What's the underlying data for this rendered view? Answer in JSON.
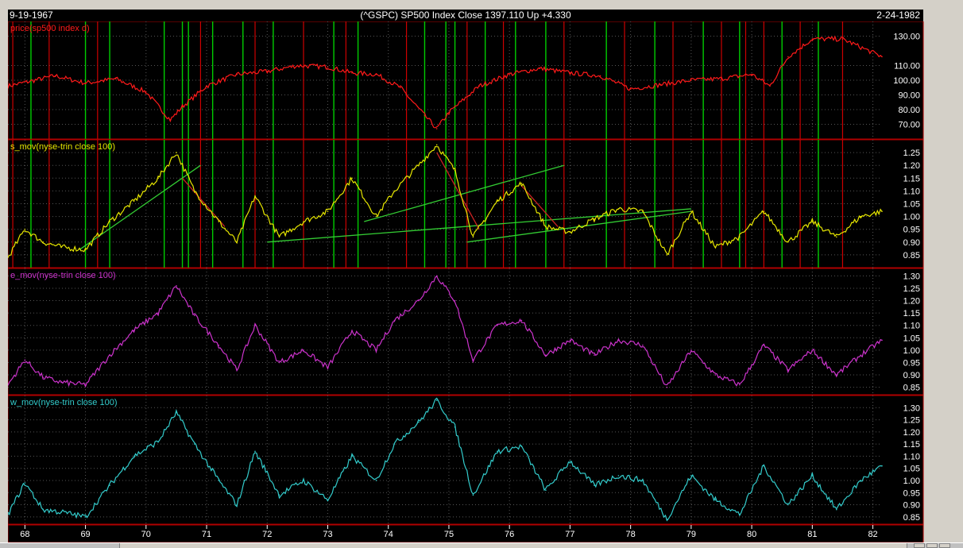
{
  "header": {
    "start_date": "9-19-1967",
    "title": "(^GSPC)  SP500 Index    Close 1397.110   Up +4.330",
    "end_date": "2-24-1982"
  },
  "colors": {
    "background": "#000000",
    "panel_border": "#b00000",
    "price_line": "#ff1a1a",
    "s_mov_line": "#e6e600",
    "e_mov_line": "#cc33cc",
    "w_mov_line": "#33cccc",
    "buy_marker": "#00cc00",
    "sell_marker": "#cc0000",
    "trend_up": "#33cc33",
    "trend_down": "#cc2222",
    "axis_text": "#ffffff",
    "grid": "#555555"
  },
  "chart_data": [
    {
      "type": "line",
      "title": "price(sp500 index d)",
      "yticks": [
        70,
        80,
        90,
        100,
        110,
        130
      ],
      "ytick_labels": [
        "70.00",
        "80.00",
        "90.00",
        "100.00",
        "110.00",
        "130.00"
      ],
      "ylim": [
        60,
        140
      ],
      "x": [
        67.72,
        68.5,
        69.0,
        69.5,
        70.0,
        70.4,
        70.6,
        71.0,
        71.5,
        72.0,
        72.5,
        73.0,
        73.4,
        73.8,
        74.2,
        74.6,
        74.8,
        75.0,
        75.5,
        76.0,
        76.5,
        77.0,
        77.5,
        78.0,
        78.5,
        79.0,
        79.5,
        80.0,
        80.3,
        80.6,
        81.0,
        81.5,
        82.15
      ],
      "y": [
        96,
        103,
        98,
        101,
        92,
        73,
        82,
        96,
        104,
        106,
        110,
        109,
        105,
        104,
        95,
        76,
        67,
        78,
        96,
        104,
        108,
        105,
        103,
        94,
        97,
        100,
        101,
        104,
        96,
        116,
        128,
        128,
        116
      ],
      "buy_signals_x": [
        68.1,
        69.0,
        69.4,
        70.3,
        70.6,
        70.7,
        71.1,
        71.6,
        72.1,
        73.1,
        73.5,
        74.6,
        74.95,
        75.1,
        75.6,
        76.1,
        76.6,
        77.6,
        78.4,
        79.2,
        79.8,
        80.5,
        81.1
      ],
      "sell_signals_x": [
        67.8,
        68.4,
        69.2,
        70.9,
        71.8,
        72.6,
        73.3,
        74.3,
        75.3,
        75.9,
        76.9,
        77.9,
        78.7,
        79.5,
        79.9,
        80.2,
        80.8,
        81.5
      ]
    },
    {
      "type": "line",
      "title": "s_mov(nyse-trin close 100)",
      "yticks": [
        0.85,
        0.9,
        0.95,
        1.0,
        1.05,
        1.1,
        1.15,
        1.2,
        1.25
      ],
      "ytick_labels": [
        "0.85",
        "0.90",
        "0.95",
        "1.00",
        "1.05",
        "1.10",
        "1.15",
        "1.20",
        "1.25"
      ],
      "ylim": [
        0.8,
        1.3
      ],
      "x": [
        67.72,
        68.0,
        68.3,
        68.6,
        69.0,
        69.4,
        69.8,
        70.2,
        70.5,
        70.8,
        71.2,
        71.5,
        71.8,
        72.2,
        72.6,
        73.0,
        73.4,
        73.8,
        74.1,
        74.5,
        74.8,
        75.1,
        75.4,
        75.8,
        76.2,
        76.6,
        77.0,
        77.4,
        77.8,
        78.2,
        78.6,
        79.0,
        79.4,
        79.8,
        80.2,
        80.6,
        81.0,
        81.4,
        81.8,
        82.15
      ],
      "y": [
        0.84,
        0.95,
        0.9,
        0.88,
        0.87,
        0.98,
        1.06,
        1.15,
        1.25,
        1.1,
        0.98,
        0.9,
        1.08,
        0.92,
        0.98,
        1.02,
        1.15,
        1.0,
        1.1,
        1.2,
        1.28,
        1.18,
        0.92,
        1.06,
        1.13,
        0.96,
        0.94,
        0.99,
        1.03,
        1.02,
        0.85,
        1.02,
        0.88,
        0.92,
        1.02,
        0.9,
        0.98,
        0.92,
        1.0,
        1.02
      ],
      "trendlines": [
        {
          "dir": "up",
          "x": [
            68.9,
            70.9
          ],
          "y": [
            0.87,
            1.2
          ]
        },
        {
          "dir": "up",
          "x": [
            72.0,
            79.0
          ],
          "y": [
            0.9,
            1.03
          ]
        },
        {
          "dir": "up",
          "x": [
            73.6,
            76.9
          ],
          "y": [
            0.98,
            1.2
          ]
        },
        {
          "dir": "up",
          "x": [
            75.3,
            79.0
          ],
          "y": [
            0.9,
            1.02
          ]
        },
        {
          "dir": "down",
          "x": [
            70.6,
            71.3
          ],
          "y": [
            1.15,
            0.96
          ]
        },
        {
          "dir": "down",
          "x": [
            74.8,
            75.5
          ],
          "y": [
            1.25,
            0.95
          ]
        },
        {
          "dir": "down",
          "x": [
            76.2,
            76.8
          ],
          "y": [
            1.12,
            0.96
          ]
        }
      ]
    },
    {
      "type": "line",
      "title": "e_mov(nyse-trin close 100)",
      "yticks": [
        0.85,
        0.9,
        0.95,
        1.0,
        1.05,
        1.1,
        1.15,
        1.2,
        1.25,
        1.3
      ],
      "ytick_labels": [
        "0.85",
        "0.90",
        "0.95",
        "1.00",
        "1.05",
        "1.10",
        "1.15",
        "1.20",
        "1.25",
        "1.30"
      ],
      "ylim": [
        0.82,
        1.33
      ],
      "x": [
        67.72,
        68.0,
        68.3,
        68.6,
        69.0,
        69.4,
        69.8,
        70.2,
        70.5,
        70.8,
        71.2,
        71.5,
        71.8,
        72.2,
        72.6,
        73.0,
        73.4,
        73.8,
        74.1,
        74.5,
        74.8,
        75.1,
        75.4,
        75.8,
        76.2,
        76.6,
        77.0,
        77.4,
        77.8,
        78.2,
        78.6,
        79.0,
        79.4,
        79.8,
        80.2,
        80.6,
        81.0,
        81.4,
        81.8,
        82.15
      ],
      "y": [
        0.86,
        0.96,
        0.89,
        0.87,
        0.86,
        0.98,
        1.08,
        1.15,
        1.26,
        1.14,
        1.02,
        0.92,
        1.1,
        0.95,
        1.0,
        0.93,
        1.08,
        1.0,
        1.12,
        1.2,
        1.3,
        1.2,
        0.96,
        1.1,
        1.12,
        0.98,
        1.04,
        0.98,
        1.04,
        1.02,
        0.85,
        1.0,
        0.9,
        0.86,
        1.02,
        0.92,
        1.0,
        0.9,
        0.98,
        1.04
      ]
    },
    {
      "type": "line",
      "title": "w_mov(nyse-trin close 100)",
      "yticks": [
        0.85,
        0.9,
        0.95,
        1.0,
        1.05,
        1.1,
        1.15,
        1.2,
        1.25,
        1.3
      ],
      "ytick_labels": [
        "0.85",
        "0.90",
        "0.95",
        "1.00",
        "1.05",
        "1.10",
        "1.15",
        "1.20",
        "1.25",
        "1.30"
      ],
      "ylim": [
        0.82,
        1.35
      ],
      "x": [
        67.72,
        68.0,
        68.3,
        68.6,
        69.0,
        69.4,
        69.8,
        70.2,
        70.5,
        70.8,
        71.2,
        71.5,
        71.8,
        72.2,
        72.6,
        73.0,
        73.4,
        73.8,
        74.1,
        74.5,
        74.8,
        75.1,
        75.4,
        75.8,
        76.2,
        76.6,
        77.0,
        77.4,
        77.8,
        78.2,
        78.6,
        79.0,
        79.4,
        79.8,
        80.2,
        80.6,
        81.0,
        81.4,
        81.8,
        82.15
      ],
      "y": [
        0.86,
        0.99,
        0.88,
        0.87,
        0.85,
        0.98,
        1.1,
        1.16,
        1.28,
        1.15,
        1.0,
        0.9,
        1.12,
        0.94,
        1.0,
        0.92,
        1.1,
        1.0,
        1.15,
        1.24,
        1.33,
        1.22,
        0.94,
        1.12,
        1.14,
        0.96,
        1.08,
        0.98,
        1.02,
        1.0,
        0.84,
        1.02,
        0.92,
        0.86,
        1.06,
        0.9,
        1.02,
        0.88,
        1.0,
        1.06
      ]
    }
  ],
  "x_axis": {
    "ticks": [
      68,
      69,
      70,
      71,
      72,
      73,
      74,
      75,
      76,
      77,
      78,
      79,
      80,
      81,
      82
    ],
    "labels": [
      "68",
      "69",
      "70",
      "71",
      "72",
      "73",
      "74",
      "75",
      "76",
      "77",
      "78",
      "79",
      "80",
      "81",
      "82"
    ],
    "xlim": [
      67.72,
      82.15
    ]
  }
}
